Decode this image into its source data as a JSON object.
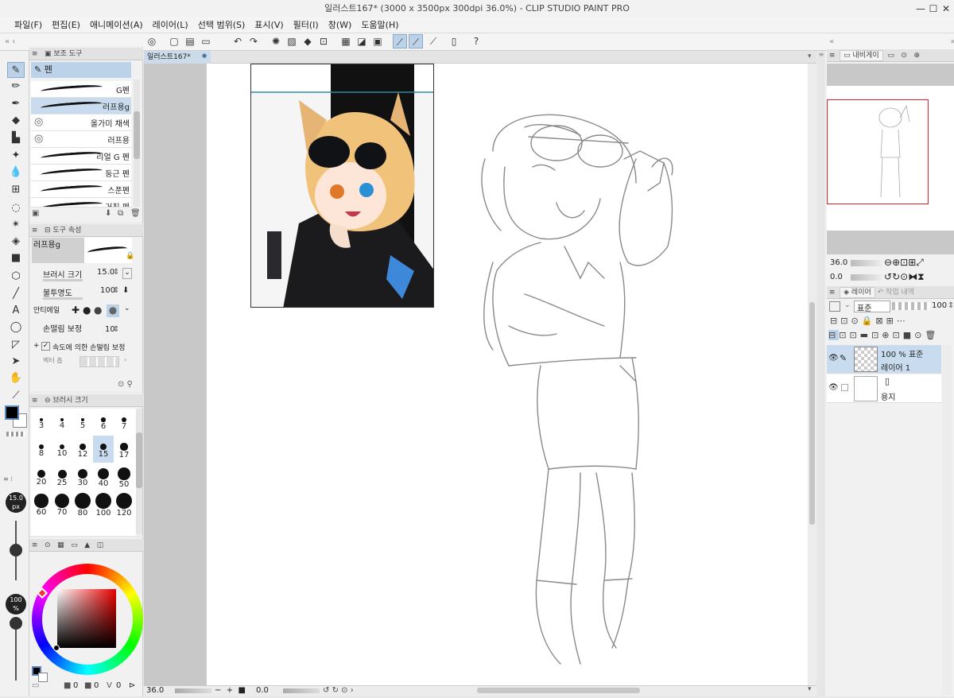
{
  "title": "일러스트167* (3000 x 3500px 300dpi 36.0%) - CLIP STUDIO PAINT PRO",
  "window": {
    "min": "—",
    "max": "☐",
    "close": "✕"
  },
  "menu": [
    "파일(F)",
    "편집(E)",
    "애니메이션(A)",
    "레이어(L)",
    "선택 범위(S)",
    "표시(V)",
    "필터(I)",
    "창(W)",
    "도움말(H)"
  ],
  "icons": {
    "command": [
      "home-icon",
      "new-icon",
      "open-icon",
      "save-icon",
      "undo-icon",
      "redo-icon",
      "loading-icon",
      "clear-icon",
      "fill-icon",
      "transform-icon",
      "grid-icon",
      "ruler-icon",
      "ruler2-icon",
      "snap-ruler-icon",
      "snap-special-icon",
      "snap-grid-icon",
      "device-icon",
      "help-icon"
    ],
    "tools": [
      "pen-tool",
      "pencil-tool",
      "marker-tool",
      "eraser-tool",
      "blend-tool",
      "airbrush-tool",
      "watercolor-tool",
      "pattern-tool",
      "lasso-tool",
      "magic-wand-tool",
      "fill-tool",
      "gradient-tool",
      "3d-tool",
      "line-tool",
      "text-tool",
      "balloon-tool",
      "frame-tool",
      "object-tool",
      "hand-tool",
      "eyedropper-tool"
    ]
  },
  "doc_tab": {
    "label": "일러스트167*",
    "marker": "●"
  },
  "subtool": {
    "header": "보조 도구",
    "group": "펜",
    "items": [
      "G펜",
      "러프용g",
      "올가미 채색",
      "러프용",
      "리얼 G 펜",
      "둥근 펜",
      "스푼펜",
      "거친 펜"
    ]
  },
  "toolprop": {
    "header": "도구 속성",
    "name": "러프용g",
    "brush_size_label": "브러시 크기",
    "brush_size": "15.0",
    "opacity_label": "불투명도",
    "opacity": "100",
    "antialias_label": "안티에일",
    "stab_label": "손떨림 보정",
    "stab": "10",
    "speed_label": "속도에 의한 손떨림 보정",
    "vector_label": "벡터 흡"
  },
  "brushsize": {
    "header": "브러시 크기",
    "sizes": [
      "3",
      "4",
      "5",
      "6",
      "7",
      "8",
      "10",
      "12",
      "15",
      "17",
      "20",
      "25",
      "30",
      "40",
      "50",
      "60",
      "70",
      "80",
      "100",
      "120"
    ]
  },
  "side_indicators": {
    "size": "15.0",
    "unit": "px",
    "opacity": "100",
    "pct": "%"
  },
  "color": {
    "fg": "#000000",
    "bg": "#ffffff",
    "val1": "0",
    "val2": "0",
    "val3": "0"
  },
  "navigator": {
    "tab": "내비게이"
  },
  "nav_controls": {
    "zoom": "36.0",
    "angle": "0.0"
  },
  "layers": {
    "tab1": "레이어",
    "tab2": "작업 내역",
    "blend": "표준",
    "opacity": "100",
    "items": [
      {
        "top": "100 % 표준",
        "name": "레이어 1"
      },
      {
        "top": "",
        "name": "용지"
      }
    ]
  },
  "status": {
    "zoom": "36.0",
    "pos": "0.0"
  }
}
